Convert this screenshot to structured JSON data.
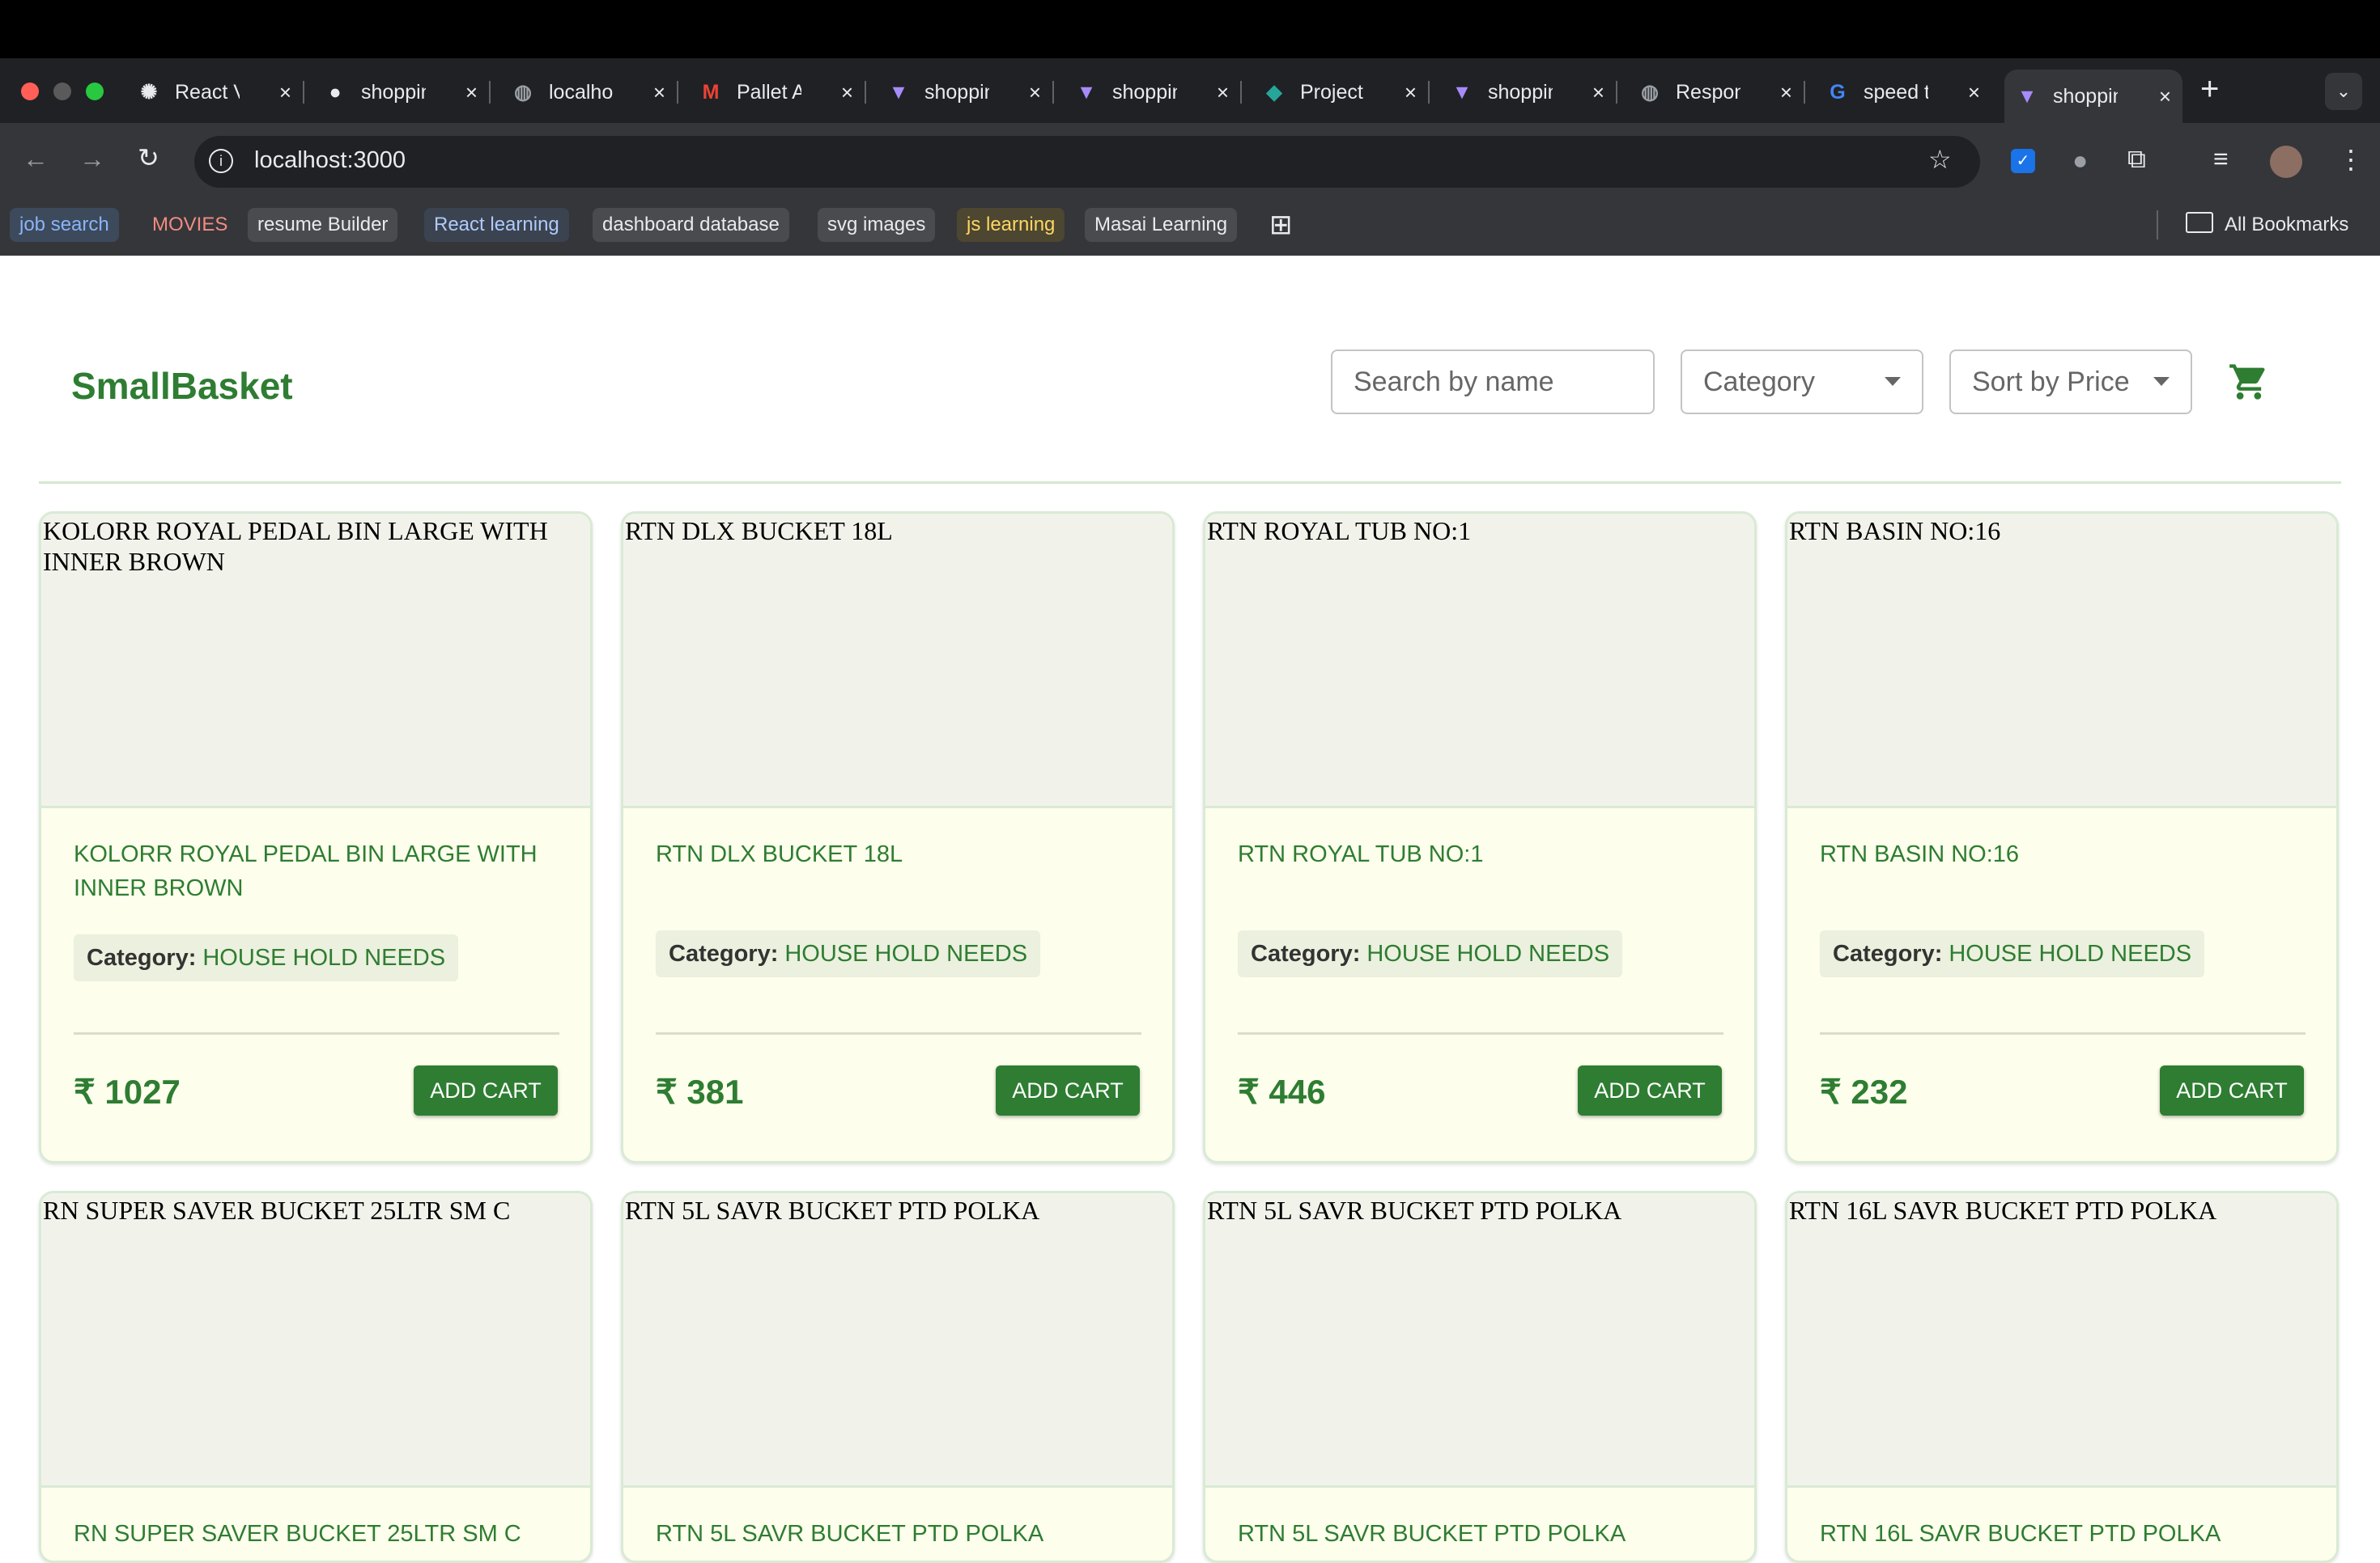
{
  "browser": {
    "tabs": [
      {
        "label": "React V",
        "icon": "openai-icon"
      },
      {
        "label": "shoppin",
        "icon": "github-icon"
      },
      {
        "label": "localhos",
        "icon": "globe-icon"
      },
      {
        "label": "Pallet A",
        "icon": "gmail-icon"
      },
      {
        "label": "shoppin",
        "icon": "vite-icon"
      },
      {
        "label": "shoppin",
        "icon": "vite-icon"
      },
      {
        "label": "Project",
        "icon": "diamond-icon"
      },
      {
        "label": "shoppin",
        "icon": "vite-icon"
      },
      {
        "label": "Respon",
        "icon": "globe-icon"
      },
      {
        "label": "speed t",
        "icon": "google-icon"
      },
      {
        "label": "shoppin",
        "icon": "vite-icon"
      }
    ],
    "url": "localhost:3000",
    "bookmarks": [
      {
        "label": "job search",
        "color": "#8ab4f8",
        "bg": "#3c4a5c"
      },
      {
        "label": "MOVIES",
        "color": "#f28b82",
        "bg": "#35363a"
      },
      {
        "label": "resume Builder",
        "color": "#e8eaed",
        "bg": "#4a4b4f"
      },
      {
        "label": "React learning",
        "color": "#aecbfa",
        "bg": "#3c4350"
      },
      {
        "label": "dashboard database",
        "color": "#e8eaed",
        "bg": "#4a4b4f"
      },
      {
        "label": "svg images",
        "color": "#e8eaed",
        "bg": "#4a4b4f"
      },
      {
        "label": "js learning",
        "color": "#fdd663",
        "bg": "#4d4630"
      },
      {
        "label": "Masai Learning",
        "color": "#e8eaed",
        "bg": "#4a4b4f"
      }
    ],
    "all_bookmarks": "All Bookmarks"
  },
  "header": {
    "logo": "SmallBasket",
    "search_placeholder": "Search by name",
    "category": "Category",
    "sort": "Sort by Price"
  },
  "products": [
    {
      "name": "KOLORR ROYAL PEDAL BIN LARGE WITH INNER BROWN",
      "category_label": "Category:",
      "category": "HOUSE HOLD NEEDS",
      "price": "₹ 1027",
      "button": "ADD CART"
    },
    {
      "name": "RTN DLX BUCKET 18L",
      "category_label": "Category:",
      "category": "HOUSE HOLD NEEDS",
      "price": "₹ 381",
      "button": "ADD CART"
    },
    {
      "name": "RTN ROYAL TUB NO:1",
      "category_label": "Category:",
      "category": "HOUSE HOLD NEEDS",
      "price": "₹ 446",
      "button": "ADD CART"
    },
    {
      "name": "RTN BASIN NO:16",
      "category_label": "Category:",
      "category": "HOUSE HOLD NEEDS",
      "price": "₹ 232",
      "button": "ADD CART"
    },
    {
      "name": "RN SUPER SAVER BUCKET 25LTR SM C"
    },
    {
      "name": "RTN 5L SAVR BUCKET PTD POLKA"
    },
    {
      "name": "RTN 5L SAVR BUCKET PTD POLKA"
    },
    {
      "name": "RTN 16L SAVR BUCKET PTD POLKA"
    }
  ]
}
